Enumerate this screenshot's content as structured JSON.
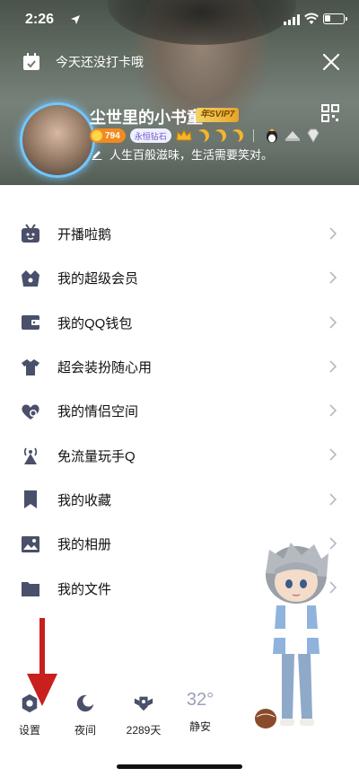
{
  "status": {
    "time": "2:26"
  },
  "checkin": {
    "text": "今天还没打卡哦"
  },
  "profile": {
    "nickname": "尘世里的小书童",
    "svip_label": "年SVIP7",
    "level": "794",
    "diamond_label": "永恒钻石",
    "signature": "人生百般滋味，生活需要笑对。"
  },
  "menu": {
    "items": [
      {
        "label": "开播啦鹅",
        "icon": "tv-icon"
      },
      {
        "label": "我的超级会员",
        "icon": "crown-basket-icon"
      },
      {
        "label": "我的QQ钱包",
        "icon": "wallet-icon"
      },
      {
        "label": "超会装扮随心用",
        "icon": "shirt-icon"
      },
      {
        "label": "我的情侣空间",
        "icon": "couple-heart-icon"
      },
      {
        "label": "免流量玩手Q",
        "icon": "antenna-icon"
      },
      {
        "label": "我的收藏",
        "icon": "bookmark-icon"
      },
      {
        "label": "我的相册",
        "icon": "photo-icon"
      },
      {
        "label": "我的文件",
        "icon": "folder-icon"
      }
    ]
  },
  "bottom": {
    "settings": "设置",
    "night": "夜间",
    "days": "2289天",
    "temperature": "32°",
    "city": "静安"
  },
  "colors": {
    "icon": "#4a4f6a",
    "arrow": "#c81f1f",
    "chevron": "#b8b8c0",
    "temp": "#9aa0b8"
  }
}
